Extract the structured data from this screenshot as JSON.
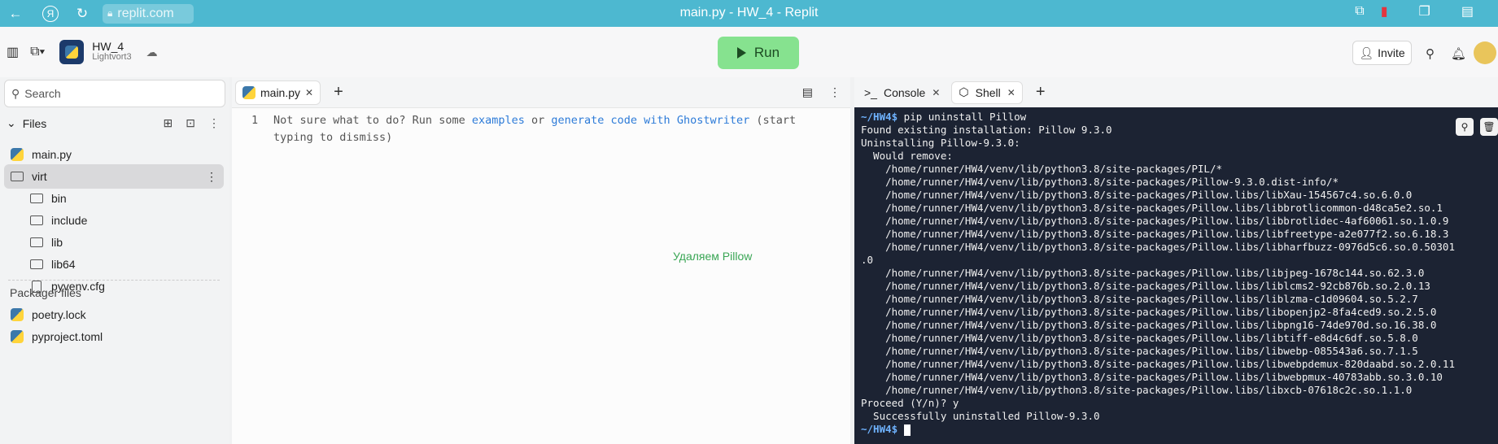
{
  "browser": {
    "url": "replit.com",
    "title": "main.py - HW_4 - Replit"
  },
  "header": {
    "project_name": "HW_4",
    "project_owner": "Lightvort3",
    "run_label": "Run",
    "invite_label": "Invite"
  },
  "sidebar": {
    "search_placeholder": "Search",
    "files_label": "Files",
    "items": [
      {
        "label": "main.py",
        "type": "python"
      },
      {
        "label": "virt",
        "type": "folder"
      },
      {
        "label": "bin",
        "type": "folder"
      },
      {
        "label": "include",
        "type": "folder"
      },
      {
        "label": "lib",
        "type": "folder"
      },
      {
        "label": "lib64",
        "type": "folder"
      },
      {
        "label": "pyvenv.cfg",
        "type": "file"
      }
    ],
    "packager_label": "Packager files",
    "packager_items": [
      {
        "label": "poetry.lock",
        "type": "python"
      },
      {
        "label": "pyproject.toml",
        "type": "python"
      }
    ]
  },
  "editor": {
    "tab_label": "main.py",
    "line_number": "1",
    "hint_prefix": "Not sure what to do? Run some ",
    "hint_link1": "examples",
    "hint_mid": " or ",
    "hint_link2": "generate code with Ghostwriter",
    "hint_suffix": " (start typing to dismiss)",
    "annotation": "Удаляем Pillow"
  },
  "right_panel": {
    "tab_console": "Console",
    "tab_shell": "Shell"
  },
  "terminal": {
    "prompt": "~/HW4$",
    "command": " pip uninstall Pillow",
    "lines": [
      "Found existing installation: Pillow 9.3.0",
      "Uninstalling Pillow-9.3.0:",
      "  Would remove:",
      "    /home/runner/HW4/venv/lib/python3.8/site-packages/PIL/*",
      "    /home/runner/HW4/venv/lib/python3.8/site-packages/Pillow-9.3.0.dist-info/*",
      "    /home/runner/HW4/venv/lib/python3.8/site-packages/Pillow.libs/libXau-154567c4.so.6.0.0",
      "    /home/runner/HW4/venv/lib/python3.8/site-packages/Pillow.libs/libbrotlicommon-d48ca5e2.so.1",
      "    /home/runner/HW4/venv/lib/python3.8/site-packages/Pillow.libs/libbrotlidec-4af60061.so.1.0.9",
      "    /home/runner/HW4/venv/lib/python3.8/site-packages/Pillow.libs/libfreetype-a2e077f2.so.6.18.3",
      "    /home/runner/HW4/venv/lib/python3.8/site-packages/Pillow.libs/libharfbuzz-0976d5c6.so.0.50301",
      ".0",
      "    /home/runner/HW4/venv/lib/python3.8/site-packages/Pillow.libs/libjpeg-1678c144.so.62.3.0",
      "    /home/runner/HW4/venv/lib/python3.8/site-packages/Pillow.libs/liblcms2-92cb876b.so.2.0.13",
      "    /home/runner/HW4/venv/lib/python3.8/site-packages/Pillow.libs/liblzma-c1d09604.so.5.2.7",
      "    /home/runner/HW4/venv/lib/python3.8/site-packages/Pillow.libs/libopenjp2-8fa4ced9.so.2.5.0",
      "    /home/runner/HW4/venv/lib/python3.8/site-packages/Pillow.libs/libpng16-74de970d.so.16.38.0",
      "    /home/runner/HW4/venv/lib/python3.8/site-packages/Pillow.libs/libtiff-e8d4c6df.so.5.8.0",
      "    /home/runner/HW4/venv/lib/python3.8/site-packages/Pillow.libs/libwebp-085543a6.so.7.1.5",
      "    /home/runner/HW4/venv/lib/python3.8/site-packages/Pillow.libs/libwebpdemux-820daabd.so.2.0.11",
      "    /home/runner/HW4/venv/lib/python3.8/site-packages/Pillow.libs/libwebpmux-40783abb.so.3.0.10",
      "    /home/runner/HW4/venv/lib/python3.8/site-packages/Pillow.libs/libxcb-07618c2c.so.1.1.0",
      "Proceed (Y/n)? y",
      "  Successfully uninstalled Pillow-9.3.0"
    ],
    "final_prompt": "~/HW4$"
  },
  "colors": {
    "browser_bar": "#4db8d0",
    "run_button": "#86e28f",
    "terminal_bg": "#1c2333",
    "prompt": "#6fb3ff",
    "link": "#2d7bd8",
    "annotation": "#3aa655"
  }
}
